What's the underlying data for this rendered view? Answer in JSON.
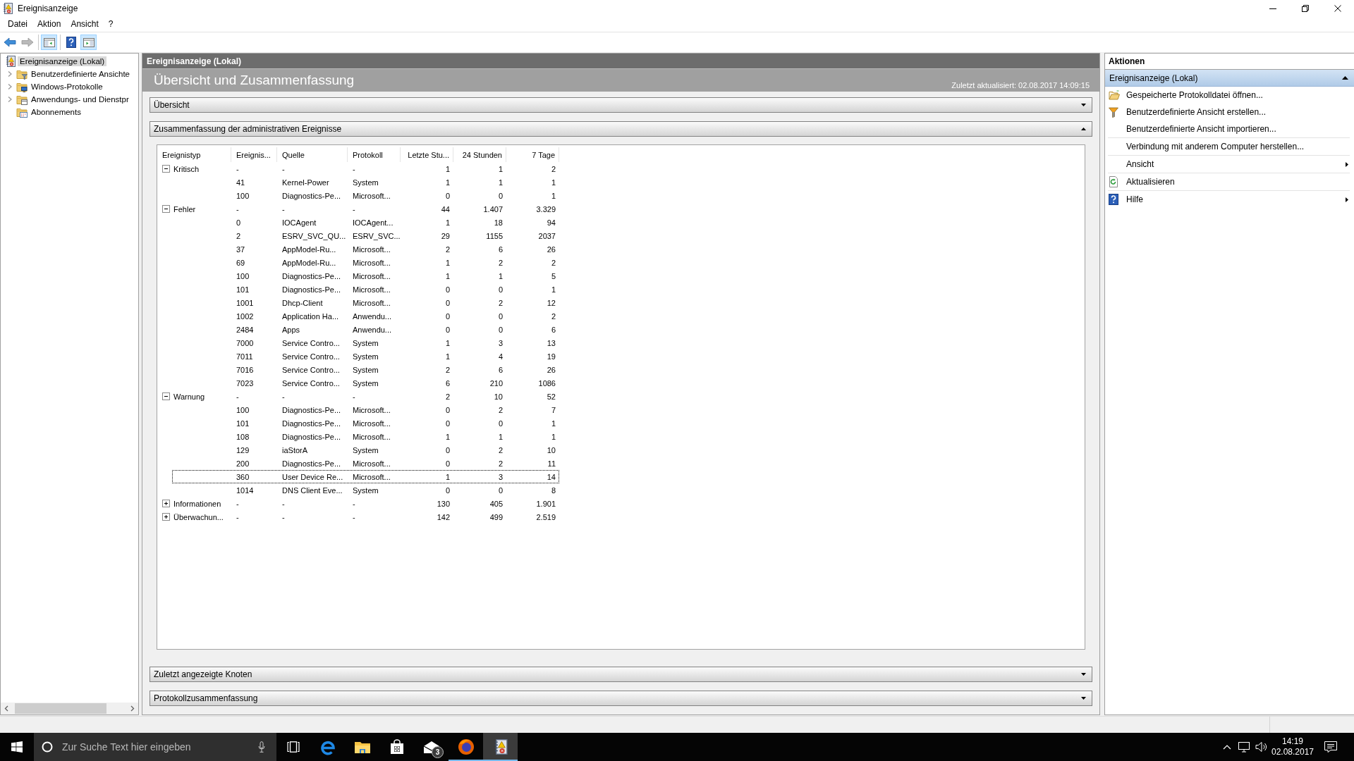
{
  "window": {
    "title": "Ereignisanzeige"
  },
  "menu": [
    {
      "label": "Datei"
    },
    {
      "label": "Aktion"
    },
    {
      "label": "Ansicht"
    },
    {
      "label": "?"
    }
  ],
  "toolbar": {
    "buttons": [
      {
        "disabled": false,
        "pressed": false
      },
      {
        "disabled": true,
        "pressed": false
      },
      {
        "disabled": false,
        "pressed": true
      },
      {
        "disabled": false,
        "pressed": false
      },
      {
        "disabled": false,
        "pressed": true
      }
    ]
  },
  "tree": {
    "items": [
      {
        "label": "Ereignisanzeige (Lokal)",
        "selected": true,
        "children": [
          {
            "label": "Benutzerdefinierte Ansichte",
            "expandable": true,
            "expanded": false,
            "selected": false
          },
          {
            "label": "Windows-Protokolle",
            "expandable": true,
            "expanded": false,
            "selected": false
          },
          {
            "label": "Anwendungs- und Dienstpr",
            "expandable": true,
            "expanded": false,
            "selected": false
          },
          {
            "label": "Abonnements",
            "expandable": false,
            "selected": false
          }
        ]
      }
    ]
  },
  "center": {
    "header": "Ereignisanzeige (Lokal)",
    "title": "Übersicht und Zusammenfassung",
    "last_updated": "Zuletzt aktualisiert: 02.08.2017 14:09:15",
    "sections": [
      {
        "title": "Übersicht",
        "expanded": false
      },
      {
        "title": "Zusammenfassung der administrativen Ereignisse",
        "expanded": true,
        "table": {
          "columns": [
            "Ereignistyp",
            "Ereignis...",
            "Quelle",
            "Protokoll",
            "Letzte Stu...",
            "24 Stunden",
            "7 Tage"
          ],
          "groups": [
            {
              "label": "Kritisch",
              "cells": [
                "-",
                "-",
                "-",
                "1",
                "1",
                "2"
              ],
              "expanded": true,
              "selected": false,
              "children": [
                {
                  "cells": [
                    "41",
                    "Kernel-Power",
                    "System",
                    "1",
                    "1",
                    "1"
                  ],
                  "selected": false
                },
                {
                  "cells": [
                    "100",
                    "Diagnostics-Pe...",
                    "Microsoft...",
                    "0",
                    "0",
                    "1"
                  ],
                  "selected": false
                }
              ]
            },
            {
              "label": "Fehler",
              "cells": [
                "-",
                "-",
                "-",
                "44",
                "1.407",
                "3.329"
              ],
              "expanded": true,
              "selected": false,
              "children": [
                {
                  "cells": [
                    "0",
                    "IOCAgent",
                    "IOCAgent...",
                    "1",
                    "18",
                    "94"
                  ],
                  "selected": false
                },
                {
                  "cells": [
                    "2",
                    "ESRV_SVC_QU...",
                    "ESRV_SVC...",
                    "29",
                    "1155",
                    "2037"
                  ],
                  "selected": false
                },
                {
                  "cells": [
                    "37",
                    "AppModel-Ru...",
                    "Microsoft...",
                    "2",
                    "6",
                    "26"
                  ],
                  "selected": false
                },
                {
                  "cells": [
                    "69",
                    "AppModel-Ru...",
                    "Microsoft...",
                    "1",
                    "2",
                    "2"
                  ],
                  "selected": false
                },
                {
                  "cells": [
                    "100",
                    "Diagnostics-Pe...",
                    "Microsoft...",
                    "1",
                    "1",
                    "5"
                  ],
                  "selected": false
                },
                {
                  "cells": [
                    "101",
                    "Diagnostics-Pe...",
                    "Microsoft...",
                    "0",
                    "0",
                    "1"
                  ],
                  "selected": false
                },
                {
                  "cells": [
                    "1001",
                    "Dhcp-Client",
                    "Microsoft...",
                    "0",
                    "2",
                    "12"
                  ],
                  "selected": false
                },
                {
                  "cells": [
                    "1002",
                    "Application Ha...",
                    "Anwendu...",
                    "0",
                    "0",
                    "2"
                  ],
                  "selected": false
                },
                {
                  "cells": [
                    "2484",
                    "Apps",
                    "Anwendu...",
                    "0",
                    "0",
                    "6"
                  ],
                  "selected": false
                },
                {
                  "cells": [
                    "7000",
                    "Service Contro...",
                    "System",
                    "1",
                    "3",
                    "13"
                  ],
                  "selected": false
                },
                {
                  "cells": [
                    "7011",
                    "Service Contro...",
                    "System",
                    "1",
                    "4",
                    "19"
                  ],
                  "selected": false
                },
                {
                  "cells": [
                    "7016",
                    "Service Contro...",
                    "System",
                    "2",
                    "6",
                    "26"
                  ],
                  "selected": false
                },
                {
                  "cells": [
                    "7023",
                    "Service Contro...",
                    "System",
                    "6",
                    "210",
                    "1086"
                  ],
                  "selected": false
                }
              ]
            },
            {
              "label": "Warnung",
              "cells": [
                "-",
                "-",
                "-",
                "2",
                "10",
                "52"
              ],
              "expanded": true,
              "selected": false,
              "children": [
                {
                  "cells": [
                    "100",
                    "Diagnostics-Pe...",
                    "Microsoft...",
                    "0",
                    "2",
                    "7"
                  ],
                  "selected": false
                },
                {
                  "cells": [
                    "101",
                    "Diagnostics-Pe...",
                    "Microsoft...",
                    "0",
                    "0",
                    "1"
                  ],
                  "selected": false
                },
                {
                  "cells": [
                    "108",
                    "Diagnostics-Pe...",
                    "Microsoft...",
                    "1",
                    "1",
                    "1"
                  ],
                  "selected": false
                },
                {
                  "cells": [
                    "129",
                    "iaStorA",
                    "System",
                    "0",
                    "2",
                    "10"
                  ],
                  "selected": false
                },
                {
                  "cells": [
                    "200",
                    "Diagnostics-Pe...",
                    "Microsoft...",
                    "0",
                    "2",
                    "11"
                  ],
                  "selected": false
                },
                {
                  "cells": [
                    "360",
                    "User Device Re...",
                    "Microsoft...",
                    "1",
                    "3",
                    "14"
                  ],
                  "selected": true
                },
                {
                  "cells": [
                    "1014",
                    "DNS Client Eve...",
                    "System",
                    "0",
                    "0",
                    "8"
                  ],
                  "selected": false
                }
              ]
            },
            {
              "label": "Informationen",
              "cells": [
                "-",
                "-",
                "-",
                "130",
                "405",
                "1.901"
              ],
              "expanded": false,
              "selected": false
            },
            {
              "label": "Überwachun...",
              "cells": [
                "-",
                "-",
                "-",
                "142",
                "499",
                "2.519"
              ],
              "expanded": false,
              "selected": false
            }
          ]
        }
      },
      {
        "title": "Zuletzt angezeigte Knoten",
        "expanded": false
      },
      {
        "title": "Protokollzusammenfassung",
        "expanded": false
      }
    ]
  },
  "actions": {
    "title": "Aktionen",
    "section": {
      "title": "Ereignisanzeige (Lokal)",
      "expanded": true
    },
    "groups": [
      {
        "items": [
          {
            "label": "Gespeicherte Protokolldatei öffnen...",
            "submenu": false
          },
          {
            "label": "Benutzerdefinierte Ansicht erstellen...",
            "submenu": false
          },
          {
            "label": "Benutzerdefinierte Ansicht importieren...",
            "submenu": false
          }
        ]
      },
      {
        "items": [
          {
            "label": "Verbindung mit anderem Computer herstellen...",
            "submenu": false
          }
        ]
      },
      {
        "items": [
          {
            "label": "Ansicht",
            "submenu": true
          }
        ]
      },
      {
        "items": [
          {
            "label": "Aktualisieren",
            "submenu": false
          }
        ]
      },
      {
        "items": [
          {
            "label": "Hilfe",
            "submenu": true
          }
        ]
      }
    ]
  },
  "taskbar": {
    "search": {
      "placeholder": "Zur Suche Text hier eingeben"
    },
    "apps": [
      {
        "running": false,
        "active": false
      },
      {
        "running": false,
        "active": false
      },
      {
        "running": false,
        "active": false
      },
      {
        "running": false,
        "active": false,
        "badge": "3"
      },
      {
        "running": true,
        "active": false
      },
      {
        "running": true,
        "active": true
      }
    ],
    "clock": {
      "time": "14:19",
      "date": "02.08.2017"
    }
  }
}
